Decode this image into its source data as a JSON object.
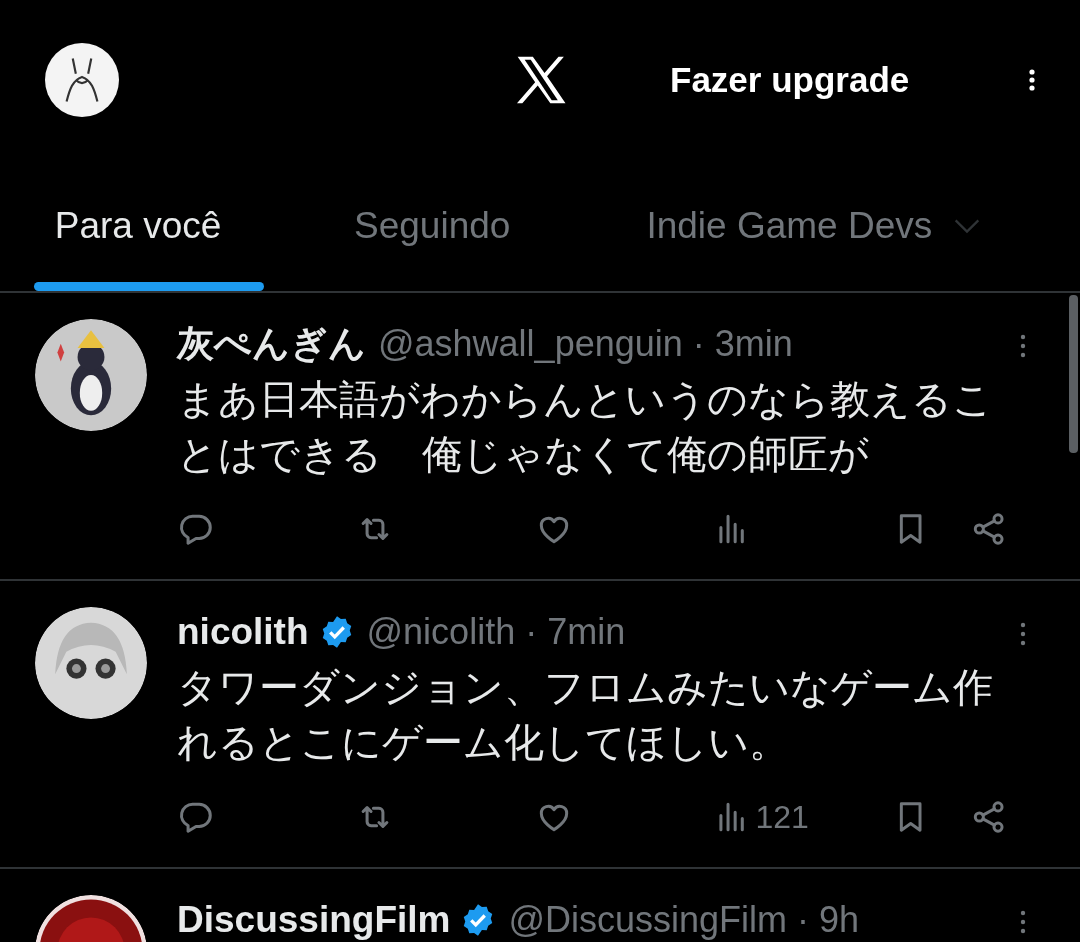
{
  "header": {
    "upgrade_label": "Fazer upgrade"
  },
  "tabs": [
    {
      "label": "Para você",
      "selected": true,
      "dropdown": false
    },
    {
      "label": "Seguindo",
      "selected": false,
      "dropdown": false
    },
    {
      "label": "Indie Game Devs",
      "selected": false,
      "dropdown": true
    }
  ],
  "tweets": [
    {
      "name": "灰ぺんぎん",
      "verified": false,
      "meta": "@ashwall_penguin · 3min",
      "text": "まあ日本語がわからんというのなら教えることはできる　俺じゃなくて俺の師匠が"
    },
    {
      "name": "nicolith",
      "verified": true,
      "meta": "@nicolith · 7min",
      "text": "タワーダンジョン、フロムみたいなゲーム作れるとこにゲーム化してほしい。",
      "views": "121"
    },
    {
      "name": "DiscussingFilm",
      "verified": true,
      "meta": "@DiscussingFilm · 9h"
    }
  ]
}
